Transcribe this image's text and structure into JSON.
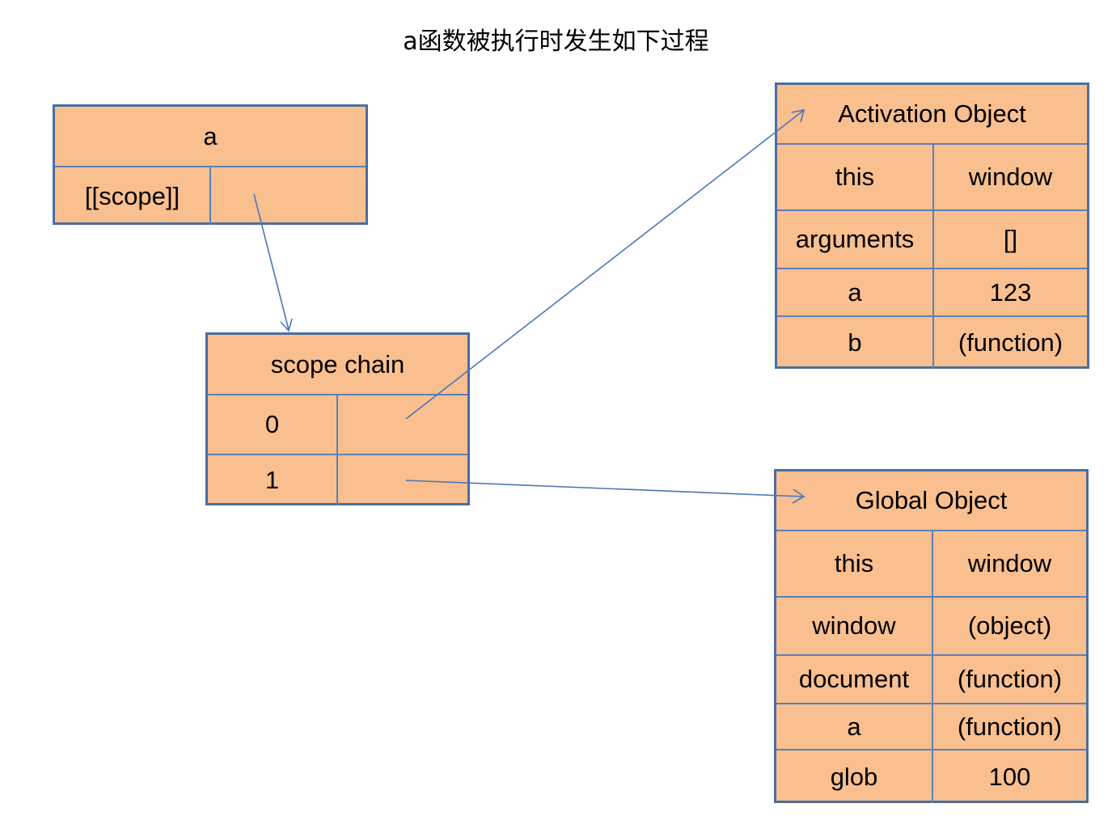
{
  "title": "a函数被执行时发生如下过程",
  "box_a": {
    "header": "a",
    "rows": [
      {
        "key": "[[scope]]",
        "value": ""
      }
    ]
  },
  "scope_chain": {
    "header": "scope chain",
    "rows": [
      {
        "key": "0",
        "value": ""
      },
      {
        "key": "1",
        "value": ""
      }
    ]
  },
  "activation_object": {
    "header": "Activation Object",
    "rows": [
      {
        "key": "this",
        "value": "window"
      },
      {
        "key": "arguments",
        "value": "[]"
      },
      {
        "key": "a",
        "value": "123"
      },
      {
        "key": "b",
        "value": "(function)"
      }
    ]
  },
  "global_object": {
    "header": "Global Object",
    "rows": [
      {
        "key": "this",
        "value": "window"
      },
      {
        "key": "window",
        "value": "(object)"
      },
      {
        "key": "document",
        "value": "(function)"
      },
      {
        "key": "a",
        "value": "(function)"
      },
      {
        "key": "glob",
        "value": "100"
      }
    ]
  },
  "colors": {
    "box_fill": "#F9BF8F",
    "border": "#4A6EA0",
    "arrow": "#4A76B8"
  }
}
